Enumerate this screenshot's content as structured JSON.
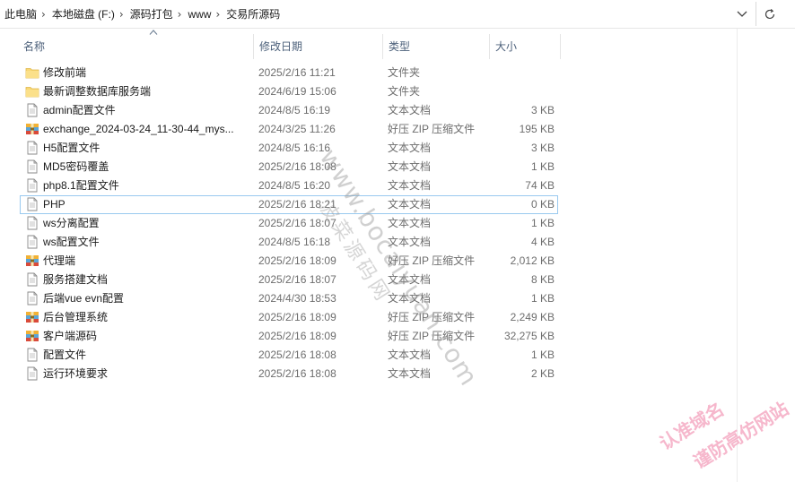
{
  "address_bar": {
    "breadcrumbs": [
      "此电脑",
      "本地磁盘 (F:)",
      "源码打包",
      "www",
      "交易所源码"
    ],
    "separator": "›"
  },
  "columns": {
    "name": "名称",
    "date": "修改日期",
    "type": "类型",
    "size": "大小"
  },
  "files": [
    {
      "icon": "folder-icon",
      "name": "修改前端",
      "date": "2025/2/16 11:21",
      "type": "文件夹",
      "size": ""
    },
    {
      "icon": "folder-icon",
      "name": "最新调整数据库服务端",
      "date": "2024/6/19 15:06",
      "type": "文件夹",
      "size": ""
    },
    {
      "icon": "text-file-icon",
      "name": "admin配置文件",
      "date": "2024/8/5 16:19",
      "type": "文本文档",
      "size": "3 KB"
    },
    {
      "icon": "zip-archive-icon",
      "name": "exchange_2024-03-24_11-30-44_mys...",
      "date": "2024/3/25 11:26",
      "type": "好压 ZIP 压缩文件",
      "size": "195 KB"
    },
    {
      "icon": "text-file-icon",
      "name": "H5配置文件",
      "date": "2024/8/5 16:16",
      "type": "文本文档",
      "size": "3 KB"
    },
    {
      "icon": "text-file-icon",
      "name": "MD5密码覆盖",
      "date": "2025/2/16 18:08",
      "type": "文本文档",
      "size": "1 KB"
    },
    {
      "icon": "text-file-icon",
      "name": "php8.1配置文件",
      "date": "2024/8/5 16:20",
      "type": "文本文档",
      "size": "74 KB"
    },
    {
      "icon": "text-file-icon",
      "name": "PHP",
      "date": "2025/2/16 18:21",
      "type": "文本文档",
      "size": "0 KB",
      "selected": true
    },
    {
      "icon": "text-file-icon",
      "name": "ws分离配置",
      "date": "2025/2/16 18:07",
      "type": "文本文档",
      "size": "1 KB"
    },
    {
      "icon": "text-file-icon",
      "name": "ws配置文件",
      "date": "2024/8/5 16:18",
      "type": "文本文档",
      "size": "4 KB"
    },
    {
      "icon": "zip-archive-icon",
      "name": "代理端",
      "date": "2025/2/16 18:09",
      "type": "好压 ZIP 压缩文件",
      "size": "2,012 KB"
    },
    {
      "icon": "text-file-icon",
      "name": "服务搭建文档",
      "date": "2025/2/16 18:07",
      "type": "文本文档",
      "size": "8 KB"
    },
    {
      "icon": "text-file-icon",
      "name": "后端vue evn配置",
      "date": "2024/4/30 18:53",
      "type": "文本文档",
      "size": "1 KB"
    },
    {
      "icon": "zip-archive-icon",
      "name": "后台管理系统",
      "date": "2025/2/16 18:09",
      "type": "好压 ZIP 压缩文件",
      "size": "2,249 KB"
    },
    {
      "icon": "zip-archive-icon",
      "name": "客户端源码",
      "date": "2025/2/16 18:09",
      "type": "好压 ZIP 压缩文件",
      "size": "32,275 KB"
    },
    {
      "icon": "text-file-icon",
      "name": "配置文件",
      "date": "2025/2/16 18:08",
      "type": "文本文档",
      "size": "1 KB"
    },
    {
      "icon": "text-file-icon",
      "name": "运行环境要求",
      "date": "2025/2/16 18:08",
      "type": "文本文档",
      "size": "2 KB"
    }
  ],
  "watermarks": {
    "site_url": "www.bocaiyuan.com",
    "site_name": "波菜源码网",
    "notice_line1": "认准域名",
    "notice_line2": "谨防高仿网站"
  },
  "colors": {
    "header_text": "#4c607a",
    "selection_border": "#99c9ef",
    "folder": "#f8d775",
    "watermark_pink": "#f5aac3"
  }
}
